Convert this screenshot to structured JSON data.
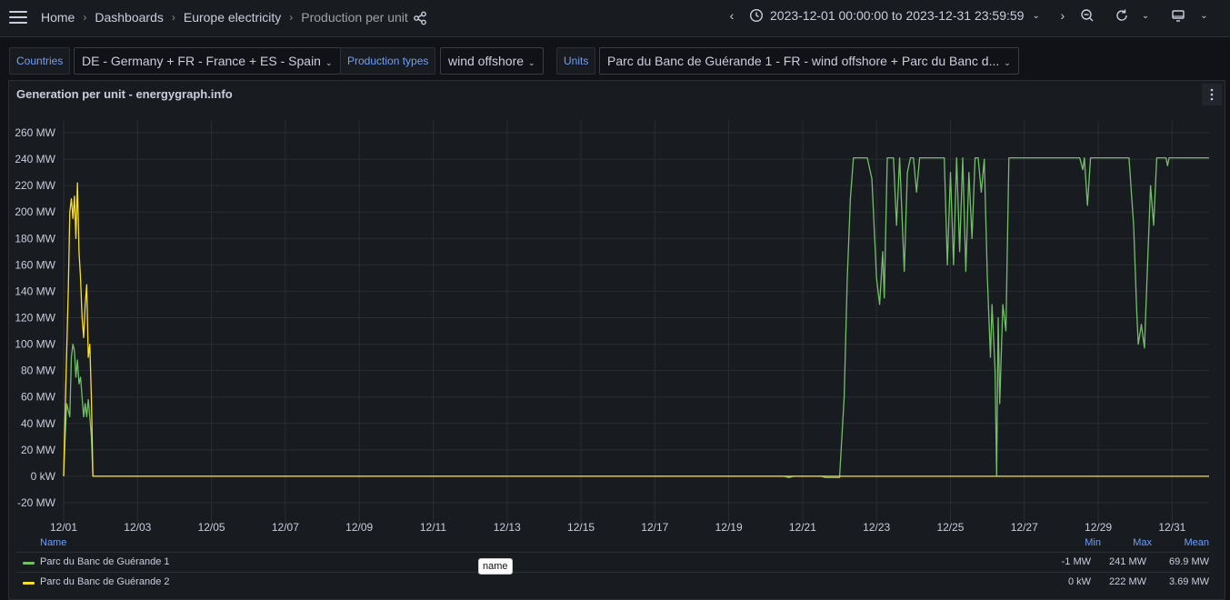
{
  "nav": {
    "breadcrumbs": [
      "Home",
      "Dashboards",
      "Europe electricity",
      "Production per unit"
    ],
    "time_range": "2023-12-01 00:00:00 to 2023-12-31 23:59:59"
  },
  "variables": [
    {
      "label": "Countries",
      "value": "DE - Germany + FR - France + ES - Spain"
    },
    {
      "label": "Production types",
      "value": "wind offshore"
    },
    {
      "label": "Units",
      "value": "Parc du Banc de Guérande 1 - FR - wind offshore + Parc du Banc d..."
    }
  ],
  "panel": {
    "title": "Generation per unit - energygraph.info"
  },
  "chart_data": {
    "type": "line",
    "ylim": [
      -20,
      260
    ],
    "yunit": "MW",
    "y_ticks": [
      "260 MW",
      "240 MW",
      "220 MW",
      "200 MW",
      "180 MW",
      "160 MW",
      "140 MW",
      "120 MW",
      "100 MW",
      "80 MW",
      "60 MW",
      "40 MW",
      "20 MW",
      "0 kW",
      "-20 MW"
    ],
    "x_ticks": [
      "12/01",
      "12/03",
      "12/05",
      "12/07",
      "12/09",
      "12/11",
      "12/13",
      "12/15",
      "12/17",
      "12/19",
      "12/21",
      "12/23",
      "12/25",
      "12/27",
      "12/29",
      "12/31"
    ],
    "xlim": [
      "2023-12-01",
      "2024-01-01"
    ],
    "grid": true,
    "series": [
      {
        "name": "Parc du Banc de Guérande 1",
        "color": "#73bf69",
        "points": [
          [
            "2023-12-01T00:00",
            0
          ],
          [
            "2023-12-01T01:00",
            30
          ],
          [
            "2023-12-01T02:00",
            55
          ],
          [
            "2023-12-01T04:00",
            45
          ],
          [
            "2023-12-01T05:00",
            90
          ],
          [
            "2023-12-01T06:00",
            100
          ],
          [
            "2023-12-01T07:00",
            95
          ],
          [
            "2023-12-01T08:00",
            75
          ],
          [
            "2023-12-01T09:00",
            88
          ],
          [
            "2023-12-01T10:00",
            70
          ],
          [
            "2023-12-01T11:00",
            75
          ],
          [
            "2023-12-01T12:00",
            60
          ],
          [
            "2023-12-01T13:00",
            45
          ],
          [
            "2023-12-01T14:00",
            55
          ],
          [
            "2023-12-01T15:00",
            45
          ],
          [
            "2023-12-01T16:00",
            58
          ],
          [
            "2023-12-01T17:00",
            45
          ],
          [
            "2023-12-01T18:00",
            30
          ],
          [
            "2023-12-01T19:00",
            0
          ],
          [
            "2023-12-20T12:00",
            0
          ],
          [
            "2023-12-20T15:00",
            -1
          ],
          [
            "2023-12-20T18:00",
            0
          ],
          [
            "2023-12-21T12:00",
            0
          ],
          [
            "2023-12-21T15:00",
            -1
          ],
          [
            "2023-12-22T00:00",
            -1
          ],
          [
            "2023-12-22T03:00",
            60
          ],
          [
            "2023-12-22T05:00",
            150
          ],
          [
            "2023-12-22T07:00",
            210
          ],
          [
            "2023-12-22T09:00",
            241
          ],
          [
            "2023-12-22T18:00",
            241
          ],
          [
            "2023-12-22T21:00",
            225
          ],
          [
            "2023-12-23T00:00",
            150
          ],
          [
            "2023-12-23T02:00",
            130
          ],
          [
            "2023-12-23T04:00",
            170
          ],
          [
            "2023-12-23T05:00",
            135
          ],
          [
            "2023-12-23T07:00",
            241
          ],
          [
            "2023-12-23T11:00",
            241
          ],
          [
            "2023-12-23T13:00",
            190
          ],
          [
            "2023-12-23T15:00",
            241
          ],
          [
            "2023-12-23T18:00",
            155
          ],
          [
            "2023-12-23T20:00",
            230
          ],
          [
            "2023-12-23T22:00",
            241
          ],
          [
            "2023-12-24T00:00",
            241
          ],
          [
            "2023-12-24T02:00",
            215
          ],
          [
            "2023-12-24T04:00",
            241
          ],
          [
            "2023-12-24T20:00",
            241
          ],
          [
            "2023-12-24T22:00",
            160
          ],
          [
            "2023-12-25T00:00",
            230
          ],
          [
            "2023-12-25T02:00",
            160
          ],
          [
            "2023-12-25T04:00",
            241
          ],
          [
            "2023-12-25T06:00",
            170
          ],
          [
            "2023-12-25T08:00",
            241
          ],
          [
            "2023-12-25T10:00",
            155
          ],
          [
            "2023-12-25T12:00",
            230
          ],
          [
            "2023-12-25T14:00",
            180
          ],
          [
            "2023-12-25T16:00",
            241
          ],
          [
            "2023-12-25T18:00",
            241
          ],
          [
            "2023-12-25T20:00",
            215
          ],
          [
            "2023-12-25T22:00",
            240
          ],
          [
            "2023-12-26T00:00",
            150
          ],
          [
            "2023-12-26T02:00",
            90
          ],
          [
            "2023-12-26T03:00",
            130
          ],
          [
            "2023-12-26T05:00",
            80
          ],
          [
            "2023-12-26T06:00",
            0
          ],
          [
            "2023-12-26T07:00",
            120
          ],
          [
            "2023-12-26T08:00",
            55
          ],
          [
            "2023-12-26T10:00",
            130
          ],
          [
            "2023-12-26T12:00",
            110
          ],
          [
            "2023-12-26T14:00",
            241
          ],
          [
            "2023-12-28T12:00",
            241
          ],
          [
            "2023-12-28T14:00",
            232
          ],
          [
            "2023-12-28T15:00",
            241
          ],
          [
            "2023-12-28T17:00",
            205
          ],
          [
            "2023-12-28T19:00",
            241
          ],
          [
            "2023-12-29T20:00",
            241
          ],
          [
            "2023-12-29T23:00",
            190
          ],
          [
            "2023-12-30T01:00",
            125
          ],
          [
            "2023-12-30T02:00",
            100
          ],
          [
            "2023-12-30T04:00",
            115
          ],
          [
            "2023-12-30T06:00",
            97
          ],
          [
            "2023-12-30T08:00",
            160
          ],
          [
            "2023-12-30T10:00",
            220
          ],
          [
            "2023-12-30T12:00",
            190
          ],
          [
            "2023-12-30T14:00",
            241
          ],
          [
            "2023-12-30T20:00",
            241
          ],
          [
            "2023-12-30T21:00",
            235
          ],
          [
            "2023-12-30T22:00",
            241
          ],
          [
            "2024-01-01T00:00",
            241
          ]
        ]
      },
      {
        "name": "Parc du Banc de Guérande 2",
        "color": "#fade2a",
        "points": [
          [
            "2023-12-01T00:00",
            0
          ],
          [
            "2023-12-01T01:00",
            50
          ],
          [
            "2023-12-01T03:00",
            140
          ],
          [
            "2023-12-01T04:00",
            200
          ],
          [
            "2023-12-01T05:00",
            210
          ],
          [
            "2023-12-01T06:00",
            195
          ],
          [
            "2023-12-01T07:00",
            212
          ],
          [
            "2023-12-01T08:00",
            180
          ],
          [
            "2023-12-01T09:00",
            222
          ],
          [
            "2023-12-01T10:00",
            170
          ],
          [
            "2023-12-01T11:00",
            150
          ],
          [
            "2023-12-01T12:00",
            120
          ],
          [
            "2023-12-01T13:00",
            105
          ],
          [
            "2023-12-01T14:00",
            130
          ],
          [
            "2023-12-01T15:00",
            145
          ],
          [
            "2023-12-01T16:00",
            90
          ],
          [
            "2023-12-01T17:00",
            100
          ],
          [
            "2023-12-01T18:00",
            60
          ],
          [
            "2023-12-01T19:00",
            0
          ],
          [
            "2024-01-01T00:00",
            0
          ]
        ]
      }
    ]
  },
  "legend": {
    "headers": {
      "name": "Name",
      "min": "Min",
      "max": "Max",
      "mean": "Mean"
    },
    "rows": [
      {
        "name": "Parc du Banc de Guérande 1",
        "color": "#73bf69",
        "min": "-1 MW",
        "max": "241 MW",
        "mean": "69.9 MW"
      },
      {
        "name": "Parc du Banc de Guérande 2",
        "color": "#fade2a",
        "min": "0 kW",
        "max": "222 MW",
        "mean": "3.69 MW"
      }
    ]
  },
  "tooltip": "name"
}
